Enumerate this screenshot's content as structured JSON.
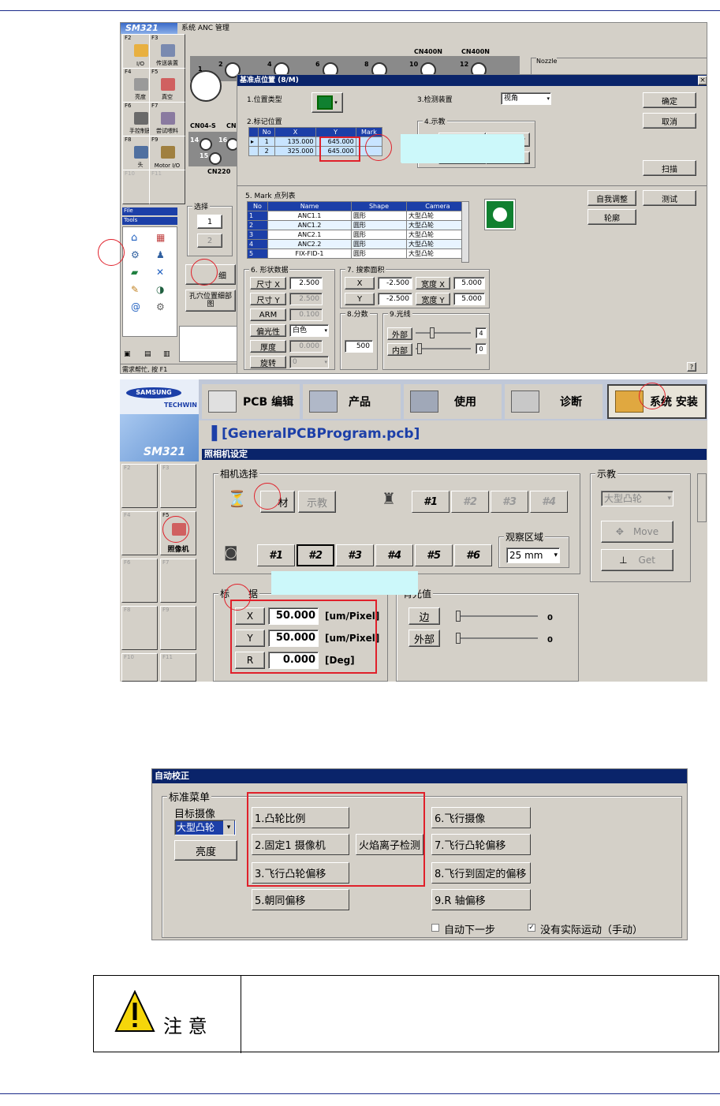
{
  "top_window": {
    "title": "SM321",
    "subtitle": "系统 ANC 管理",
    "nozzle_labels": [
      "2",
      "4",
      "6",
      "8",
      "10",
      "12"
    ],
    "nozzle_big": "1",
    "cn_labels": [
      "CN400N",
      "CN400N",
      "CN04-S",
      "CN",
      "CN220"
    ],
    "nozzle_lower": [
      "14",
      "16",
      "15"
    ],
    "nozzle_box_label": "Nozzle",
    "fkeys": [
      {
        "key": "F2",
        "name": "I/O"
      },
      {
        "key": "F3",
        "name": "传送装置"
      },
      {
        "key": "F4",
        "name": "亮度"
      },
      {
        "key": "F5",
        "name": "真空"
      },
      {
        "key": "F6",
        "name": "手控制圈"
      },
      {
        "key": "F7",
        "name": "尝试喂料"
      },
      {
        "key": "F8",
        "name": "头"
      },
      {
        "key": "F9",
        "name": "Motor I/O"
      },
      {
        "key": "F10",
        "name": ""
      },
      {
        "key": "F11",
        "name": ""
      }
    ],
    "file_menu": "File",
    "tools_menu": "Tools",
    "select_label": "选择",
    "select_1": "1",
    "select_2": "2",
    "hole_detail_btn": "孔穴位置细部图",
    "btn_partial": "细",
    "status": "需求帮忙, 按 F1"
  },
  "dialog": {
    "title": "基准点位置 (8/M)",
    "close": "×",
    "pos_type_label": "1.位置类型",
    "detect_label": "3.检测装置",
    "detect_value": "视角",
    "mark_pos_label": "2.标记位置",
    "teach_label": "4.示教",
    "ok": "确定",
    "cancel": "取消",
    "scan": "扫描",
    "mark_headers": [
      "No",
      "X",
      "Y",
      "Mark"
    ],
    "mark_rows": [
      [
        "1",
        "135.000",
        "645.000",
        ""
      ],
      [
        "2",
        "325.000",
        "645.000",
        ""
      ]
    ],
    "mark_list_label": "5. Mark 点列表",
    "list_headers": [
      "No",
      "Name",
      "Shape",
      "Camera"
    ],
    "list_rows": [
      [
        "1",
        "ANC1.1",
        "圆形",
        "大型凸轮"
      ],
      [
        "2",
        "ANC1.2",
        "圆形",
        "大型凸轮"
      ],
      [
        "3",
        "ANC2.1",
        "圆形",
        "大型凸轮"
      ],
      [
        "4",
        "ANC2.2",
        "圆形",
        "大型凸轮"
      ],
      [
        "5",
        "FIX-FID-1",
        "圆形",
        "大型凸轮"
      ]
    ],
    "self_adjust": "自我调整",
    "test": "测试",
    "contour": "轮廓",
    "shape_label": "6. 形状数据",
    "size_x_label": "尺寸 X",
    "size_x": "2.500",
    "size_y_label": "尺寸 Y",
    "size_y": "2.500",
    "arm_label": "ARM",
    "arm": "0.100",
    "polarity_label": "偏光性",
    "polarity": "白色",
    "thickness_label": "厚度",
    "thickness": "0.000",
    "rotate_label": "旋转",
    "rotate": "0",
    "search_label": "7. 搜索面积",
    "sx_label": "X",
    "sx": "-2.500",
    "sy_label": "Y",
    "sy": "-2.500",
    "wx_label": "宽度 X",
    "wx": "5.000",
    "wy_label": "宽度 Y",
    "wy": "5.000",
    "score_label": "8.分数",
    "score": "500",
    "light_label": "9.光线",
    "outer_label": "外部",
    "outer_val": "4",
    "inner_label": "内部",
    "inner_val": "0",
    "help": "?"
  },
  "camera_window": {
    "brand": "SAMSUNG",
    "brand2": "TECHWIN",
    "menus": [
      "PCB 编辑",
      "产品",
      "使用",
      "诊断",
      "系统 安装"
    ],
    "program": "[GeneralPCBProgram.pcb]",
    "sm": "SM321",
    "title": "照相机设定",
    "cam_select_label": "相机选择",
    "material_btn": "材",
    "teach_btn": "示教",
    "cam_nums_top": [
      "#1",
      "#2",
      "#3",
      "#4"
    ],
    "cam_nums_bottom": [
      "#1",
      "#2",
      "#3",
      "#4",
      "#5",
      "#6"
    ],
    "view_area_label": "观察区域",
    "view_area_value": "25 mm",
    "teach_group_label": "示教",
    "teach_select": "大型凸轮",
    "move_btn": "Move",
    "get_btn": "Get",
    "fkey_f5": "F5",
    "fkey_f5_name": "照像机",
    "fkeys_other": [
      "F2",
      "F3",
      "F4",
      "F6",
      "F7",
      "F8",
      "F9",
      "F10",
      "F11"
    ],
    "calib_label_partial": "标",
    "calib_label_rest": "据",
    "rows": [
      {
        "axis": "X",
        "value": "50.000",
        "unit": "[um/Pixel]"
      },
      {
        "axis": "Y",
        "value": "50.000",
        "unit": "[um/Pixel]"
      },
      {
        "axis": "R",
        "value": "0.000",
        "unit": "[Deg]"
      }
    ],
    "light_group": "背光值",
    "light_edge": "边",
    "light_outer": "外部",
    "light_v1": "0",
    "light_v2": "0"
  },
  "auto_calib": {
    "title": "自动校正",
    "menu_label": "标准菜单",
    "target_label": "目标摄像",
    "target_value": "大型凸轮",
    "brightness": "亮度",
    "btn1": "1.凸轮比例",
    "btn2": "2.固定1 摄像机",
    "btn_flame": "火焰离子检测",
    "btn3": "3.飞行凸轮偏移",
    "btn5": "5.朝同偏移",
    "btn6": "6.飞行摄像",
    "btn7": "7.飞行凸轮偏移",
    "btn8": "8.飞行到固定的偏移",
    "btn9": "9.R 轴偏移",
    "auto_next": "自动下一步",
    "no_motion": "没有实际运动（手动）"
  },
  "caution": {
    "label": "注  意"
  },
  "colors": {
    "accent": "#0a246a",
    "annotation": "#e0202a",
    "placeholder": "#ccf8fa",
    "table_header": "#1c3fa8"
  }
}
